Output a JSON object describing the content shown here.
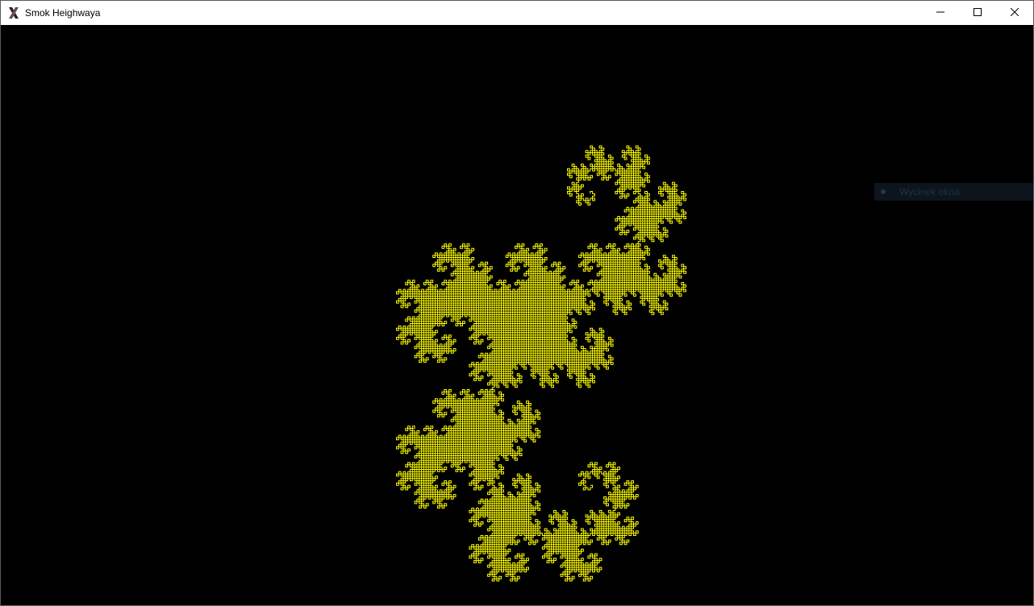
{
  "window": {
    "title": "Smok Heighwaya",
    "icon": "x-window-icon"
  },
  "controls": {
    "minimize_icon": "minimize-icon",
    "maximize_icon": "maximize-icon",
    "close_icon": "close-icon"
  },
  "overlay": {
    "label": "Wycinek okna"
  },
  "canvas": {
    "background_color": "#000000",
    "fractal_color": "#ffff00",
    "fractal": "heighway-dragon"
  }
}
